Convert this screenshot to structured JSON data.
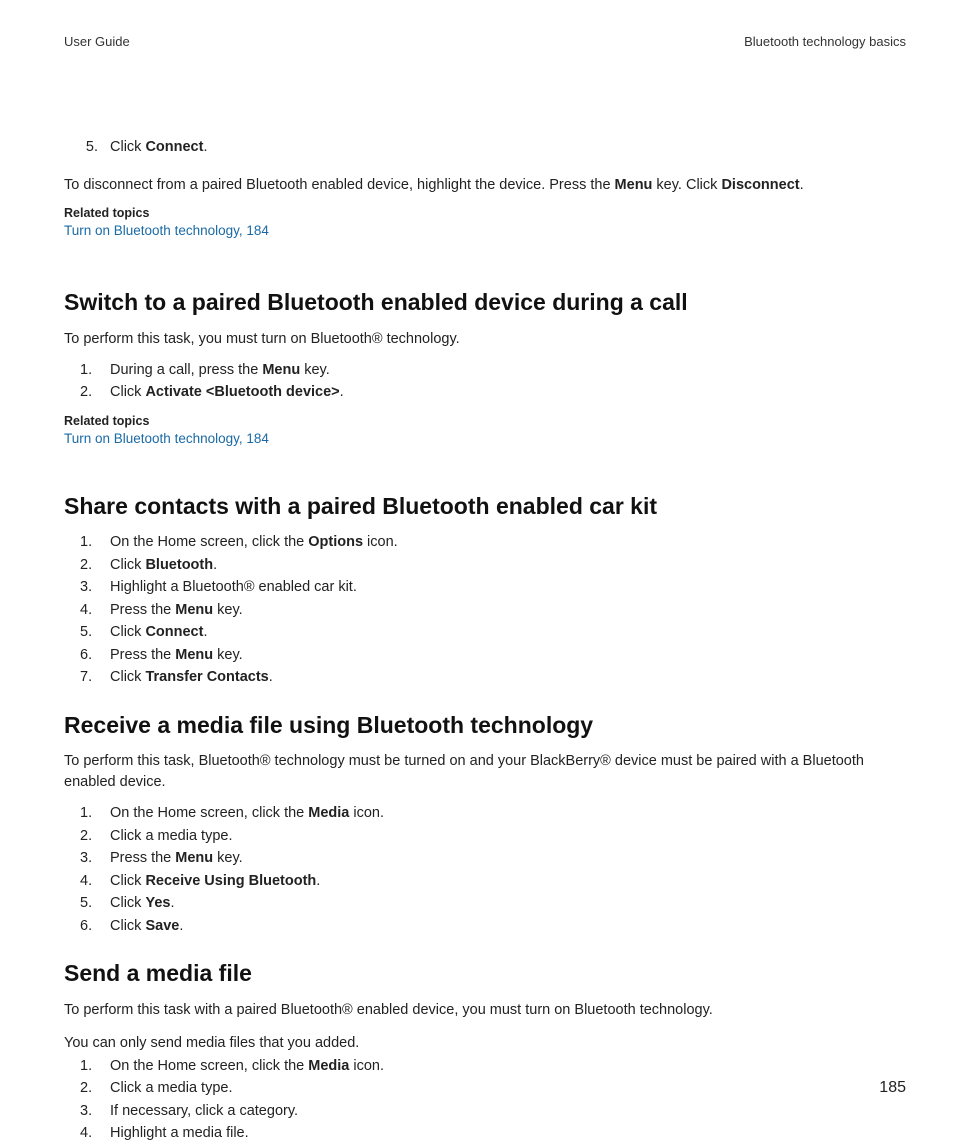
{
  "header": {
    "left": "User Guide",
    "right": "Bluetooth technology basics"
  },
  "intro_step5": {
    "num": "5.",
    "pre": "Click ",
    "bold": "Connect",
    "post": "."
  },
  "disconnect": {
    "pre": "To disconnect from a paired Bluetooth enabled device, highlight the device. Press the ",
    "b1": "Menu",
    "mid": " key. Click ",
    "b2": "Disconnect",
    "post": "."
  },
  "related1": {
    "title": "Related topics",
    "link": "Turn on Bluetooth technology, 184"
  },
  "section_switch": {
    "title": "Switch to a paired Bluetooth enabled device during a call",
    "para": "To perform this task, you must turn on Bluetooth® technology.",
    "s1": {
      "num": "1.",
      "pre": "During a call, press the ",
      "b": "Menu",
      "post": " key."
    },
    "s2": {
      "num": "2.",
      "pre": "Click ",
      "b": "Activate <Bluetooth device>",
      "post": "."
    }
  },
  "related2": {
    "title": "Related topics",
    "link": "Turn on Bluetooth technology, 184"
  },
  "section_share": {
    "title": "Share contacts with a paired Bluetooth enabled car kit",
    "s1": {
      "num": "1.",
      "pre": "On the Home screen, click the ",
      "b": "Options",
      "post": " icon."
    },
    "s2": {
      "num": "2.",
      "pre": "Click ",
      "b": "Bluetooth",
      "post": "."
    },
    "s3": {
      "num": "3.",
      "text": "Highlight a Bluetooth® enabled car kit."
    },
    "s4": {
      "num": "4.",
      "pre": "Press the ",
      "b": "Menu",
      "post": " key."
    },
    "s5": {
      "num": "5.",
      "pre": "Click ",
      "b": "Connect",
      "post": "."
    },
    "s6": {
      "num": "6.",
      "pre": "Press the ",
      "b": "Menu",
      "post": " key."
    },
    "s7": {
      "num": "7.",
      "pre": "Click ",
      "b": "Transfer Contacts",
      "post": "."
    }
  },
  "section_receive": {
    "title": "Receive a media file using Bluetooth technology",
    "para": "To perform this task, Bluetooth® technology must be turned on and your BlackBerry® device must be paired with a Bluetooth enabled device.",
    "s1": {
      "num": "1.",
      "pre": "On the Home screen, click the ",
      "b": "Media",
      "post": " icon."
    },
    "s2": {
      "num": "2.",
      "text": "Click a media type."
    },
    "s3": {
      "num": "3.",
      "pre": "Press the ",
      "b": "Menu",
      "post": " key."
    },
    "s4": {
      "num": "4.",
      "pre": "Click ",
      "b": "Receive Using Bluetooth",
      "post": "."
    },
    "s5": {
      "num": "5.",
      "pre": "Click ",
      "b": "Yes",
      "post": "."
    },
    "s6": {
      "num": "6.",
      "pre": "Click ",
      "b": "Save",
      "post": "."
    }
  },
  "section_send": {
    "title": "Send a media file",
    "para1": "To perform this task with a paired Bluetooth® enabled device, you must turn on Bluetooth technology.",
    "para2": "You can only send media files that you added.",
    "s1": {
      "num": "1.",
      "pre": "On the Home screen, click the ",
      "b": "Media",
      "post": " icon."
    },
    "s2": {
      "num": "2.",
      "text": "Click a media type."
    },
    "s3": {
      "num": "3.",
      "text": "If necessary, click a category."
    },
    "s4": {
      "num": "4.",
      "text": "Highlight a media file."
    }
  },
  "page_number": "185"
}
